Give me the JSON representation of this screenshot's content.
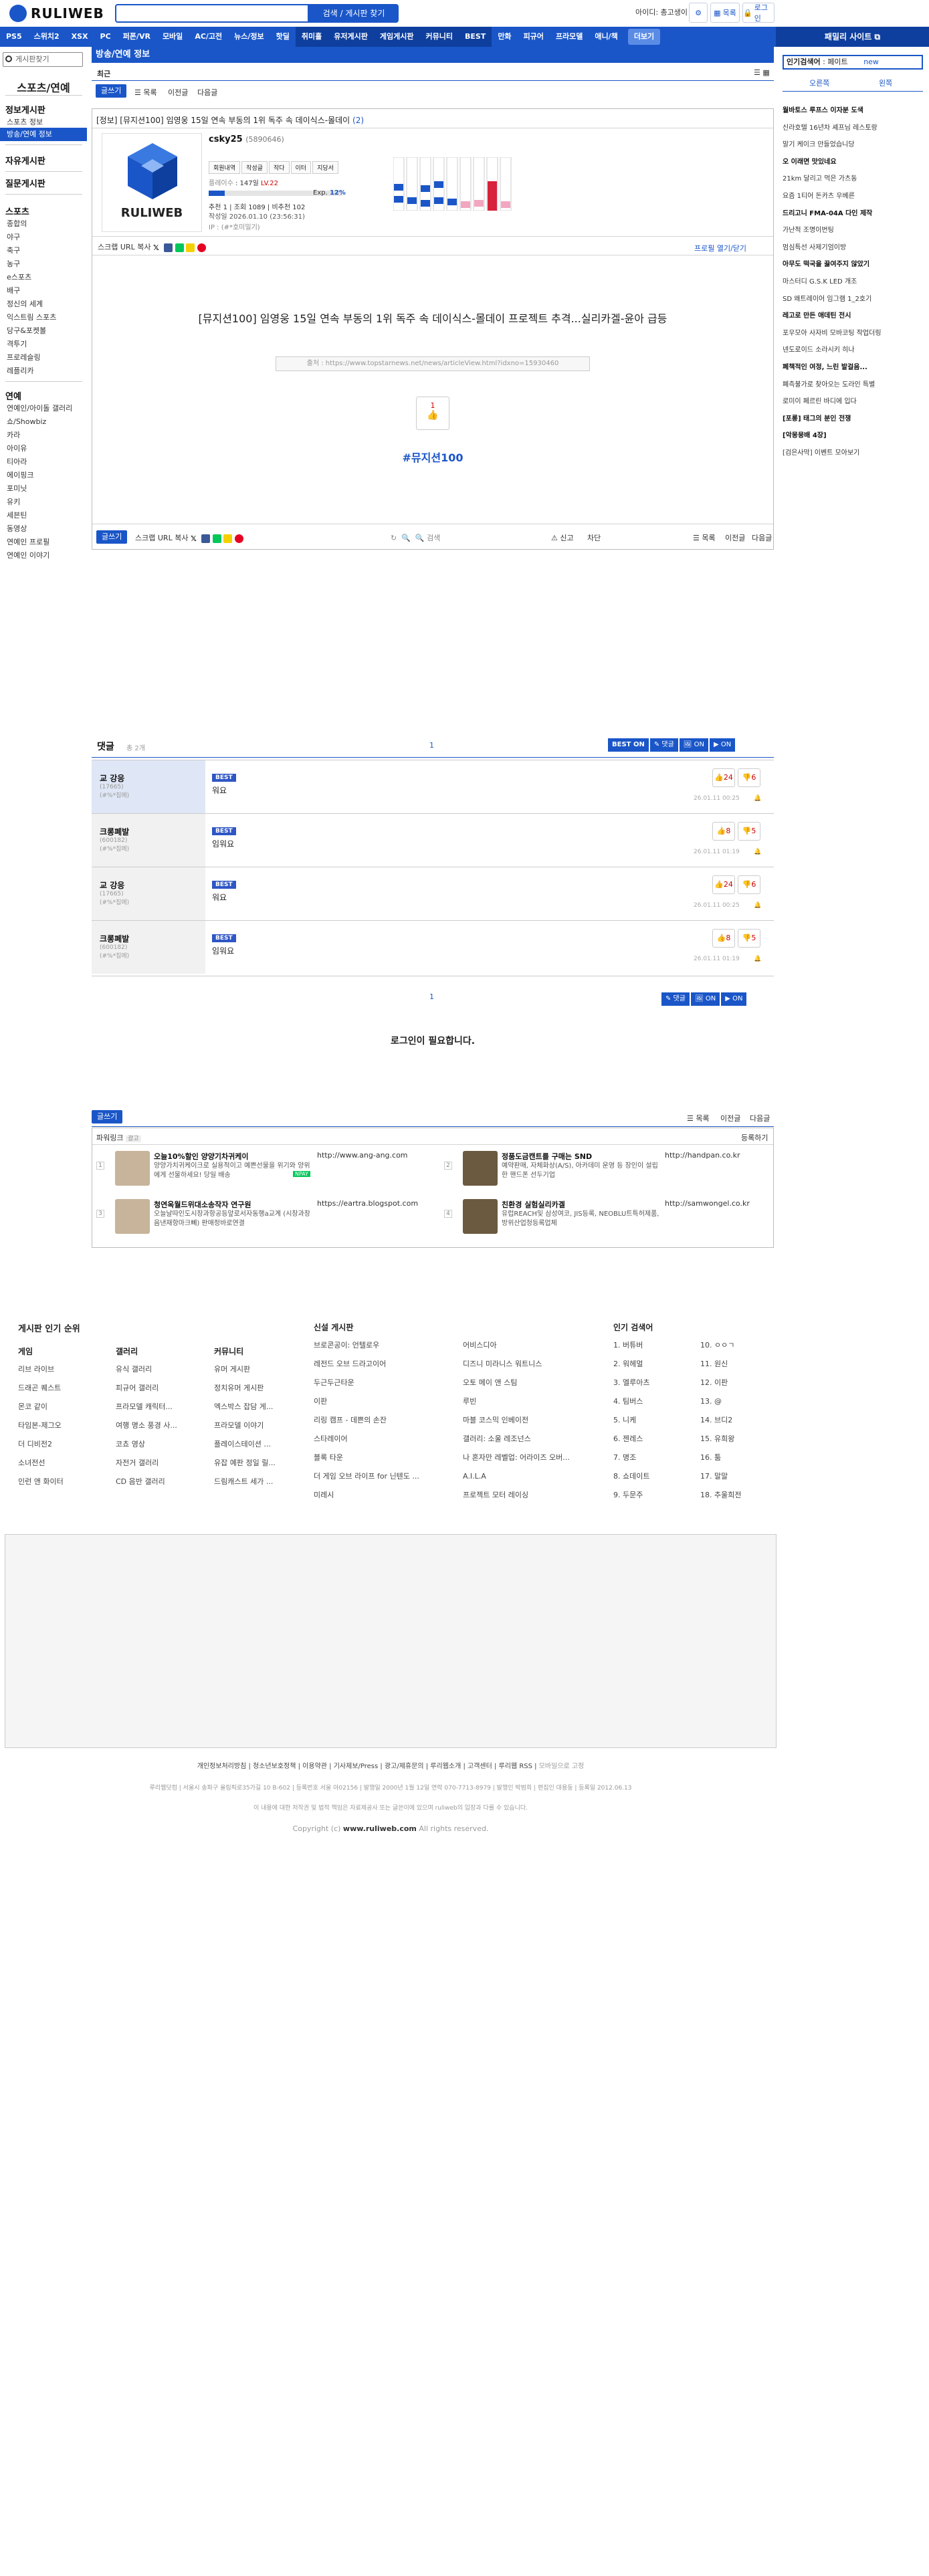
{
  "header": {
    "logo_text": "RULIWEB",
    "search_button": "검색 / 게시판 찾기",
    "user": "아이디: 총고생이",
    "icon_grid_label": "목록",
    "icon_login_label": "로그인"
  },
  "gnb": {
    "items": [
      "PS5",
      "스위치2",
      "XSX",
      "PC",
      "퍼폰/VR",
      "모바일",
      "AC/고전",
      "뉴스/정보",
      "핫딜",
      "취미홀",
      "유저게시판",
      "게임게시판",
      "커뮤니티",
      "BEST",
      "만화",
      "피규어",
      "프라모델",
      "애니/책"
    ],
    "more": "더보기",
    "partner": "패밀리 사이트"
  },
  "left": {
    "search_placeholder": "게시판찾기",
    "title": "스포츠/연예",
    "sec1": "정보게시판",
    "items1": [
      "스포츠 정보",
      "방송/연예 정보"
    ],
    "sec2": "자유게시판",
    "sec3": "질문게시판",
    "sec4": "스포츠",
    "items4": [
      "종합의",
      "야구",
      "축구",
      "농구",
      "e스포츠",
      "배구",
      "정신의 세계",
      "익스트림 스포츠",
      "당구&포켓볼",
      "격투기",
      "프로레슬링",
      "레플리카"
    ],
    "sec5": "연예",
    "items5": [
      "연예인/아이돌 갤러리",
      "쇼/Showbiz",
      "카라",
      "아이유",
      "티아라",
      "에이핑크",
      "포미닛",
      "유키",
      "세븐틴",
      "동영상",
      "연예인 프로필",
      "연예인 이야기"
    ]
  },
  "board": {
    "title": "방송/연예 정보",
    "tab_all": "최근",
    "write": "글쓰기",
    "list": "목록",
    "prev": "이전글",
    "next": "다음글"
  },
  "post": {
    "title": "[정보] [뮤지션100] 임영웅 15일 연속 부동의 1위 독주 속 데이식스-몰데이",
    "comment_count": "(2)",
    "author": "csky25",
    "author_id": "(5890646)",
    "tabs": [
      "회원내역",
      "작성글",
      "작다",
      "이터",
      "지당서"
    ],
    "level_label": "플레이수",
    "level_value": "147일",
    "lv": "LV.22",
    "exp_label": "Exp.",
    "exp_pct": "12%",
    "progress": 0.12,
    "rec": "추천 1",
    "views": "조회 1089",
    "cmts": "비추천 102",
    "date": "작성일 2026.01.10 (23:56:31)",
    "ip": "IP : (#*호미밀기)",
    "share_scrap": "스크랩",
    "share_url": "URL 복사",
    "profile_toggle": "프로필 열기/닫기",
    "body_title": "[뮤지션100] 임영웅 15일 연속 부동의 1위 독주 속 데이식스-몰데이 프로젝트 추격...실리카겔-윤아 급등",
    "source": "출처 : https://www.topstarnews.net/news/articleView.html?idxno=15930460",
    "like_count": "1",
    "hashtag": "#뮤지션100",
    "report": "신고",
    "block": "차단",
    "search_in": "검색"
  },
  "comments": {
    "title": "댓글",
    "count": "총 2개",
    "page": "1",
    "best_label": "BEST",
    "on_label": "ON",
    "reply_label": "댓글",
    "items": [
      {
        "name": "교 강응",
        "sub1": "(17665)",
        "sub2": "(#%*집에)",
        "best": "BEST",
        "text": "워요",
        "up": "24",
        "down": "6",
        "date": "26.01.11 00:25"
      },
      {
        "name": "크롱폐발",
        "sub1": "(600182)",
        "sub2": "(#%*집에)",
        "best": "BEST",
        "text": "임워요",
        "up": "8",
        "down": "5",
        "date": "26.01.11 01:19"
      },
      {
        "name": "교 강응",
        "sub1": "(17665)",
        "sub2": "(#%*집에)",
        "best": "BEST",
        "text": "워요",
        "up": "24",
        "down": "6",
        "date": "26.01.11 00:25"
      },
      {
        "name": "크롱폐발",
        "sub1": "(600182)",
        "sub2": "(#%*집에)",
        "best": "BEST",
        "text": "임워요",
        "up": "8",
        "down": "5",
        "date": "26.01.11 01:19"
      }
    ],
    "login_required": "로그인이 필요합니다."
  },
  "powerlink": {
    "title": "파워링크",
    "ad": "광고",
    "register": "등록하기",
    "ads": [
      {
        "name": "오늘10%할인 양양기차귀케이",
        "desc": "양양가치귀케이크로 실용적이고 예쁜선물을 위기와 양위에게 선물하세요! 당일 배송",
        "url": "http://www.ang-ang.com",
        "badge": "NPAY"
      },
      {
        "name": "정품도금캔트를 구매는 SND",
        "desc": "예약판매, 자체화상(A/S), 아카데미 운영 등 장인이 설립한 핸드폰 선두기업",
        "url": "http://handpan.co.kr"
      },
      {
        "name": "청연옥월드위대소송작자 연구원",
        "desc": "오늘날따인도시장과항공등앞로서자동행a교계 (시창과창음낸재항마크뻬) 판매정바로연결",
        "url": "https://eartra.blogspot.com"
      },
      {
        "name": "친환경 실험실리카겔",
        "desc": "유럽REACH및 삼성여코, JIS등록, NEOBLU트특허제품, 방위산업청등록업체",
        "url": "http://samwongel.co.kr"
      }
    ]
  },
  "footer_rank": {
    "title": "게시판 인기 순위",
    "col1_title": "게임",
    "col1": [
      "리브 라이브",
      "드래곤 퀘스트",
      "몬코 같이",
      "타임본-제그오",
      "더 디비전2",
      "소녀전선",
      "인런 앤 화이터"
    ],
    "col2_title": "갤러리",
    "col2": [
      "유식 갤러리",
      "피규어 갤러리",
      "프라모델 캐릭터...",
      "여행 명소 풍경 사...",
      "코쵸 영상",
      "자전거 갤러리",
      "CD 음반 갤러리"
    ],
    "col3_title": "커뮤니티",
    "col3": [
      "유머 게시판",
      "정치유머 게시판",
      "엑스박스 잡담 게...",
      "프라모델 이야기",
      "플레이스테이션 ...",
      "유잡 예판 정일 릴...",
      "드림캐스트 세가 ..."
    ],
    "new_title": "신설 게시판",
    "new1": [
      "브로콘공이: 언텔로우",
      "레전드 오브 드라고이어",
      "두근두근타운",
      "이판",
      "리링 캠프 - 데쁜의 손잔",
      "스타레이어",
      "블록 타운",
      "더 게임 오브 라이프 for 닌텐도 ...",
      "미레시"
    ],
    "new2": [
      "어비스디아",
      "디즈니 미라니스 워트니스",
      "오토 메이 앤 스팀",
      "루빈",
      "마블 코스믹 인베이전",
      "갤러리: 소울 레조넌스",
      "나 혼자만 레벨업: 어라이즈 오버...",
      "A.I.L.A",
      "프로젝트 모터 레이싱"
    ],
    "hot_title": "인기 검색어",
    "hot1": [
      "1. 버튜버",
      "2. 워헤멀",
      "3. 엘루아츠",
      "4. 팀버스",
      "5. 니케",
      "6. 젠레스",
      "7. 명조",
      "8. 쇼데이트",
      "9. 두문주"
    ],
    "hot2": [
      "10. ㅇㅇㄱ",
      "11. 원신",
      "12. 이판",
      "13. @",
      "14. 브디2",
      "15. 유희왕",
      "16. 툼",
      "17. 말말",
      "18. 추울희전"
    ]
  },
  "footer": {
    "links": [
      "개인정보처리방침",
      "청소년보호정책",
      "이용약관",
      "기사제보/Press",
      "광고/제휴문의",
      "루리웹소개",
      "고객센터",
      "루리웹 RSS",
      "모바일으로 고정"
    ],
    "company": "루리웹닷컴 | 서울시 송파구 올림픽로35가길 10 B-602 | 등록번호 서울 아02156 | 발행일 2000년 1월 12일 연락 070-7713-8979 | 발행인 박범희 | 편집인 대용동 | 등록일 2012.06.13",
    "notice": "이 내용에 대한 저작권 및 법적 책임은 자료제공사 또는 글쓴이에 있으며 ruliweb의 입장과 다를 수 있습니다.",
    "copyright": "Copyright (c) ",
    "domain": "www.ruliweb.com",
    "rights": " All rights reserved."
  },
  "right": {
    "tab1": "인기검색어",
    "tab2_label": "페이트",
    "tab2_new": "new",
    "sub1": "오른쪽",
    "sub2": "왼쪽",
    "items": [
      "월바토스 루프스 이자분 도색",
      "신라호텔 16년차 셰프님 레스토랑",
      "말기 케이크 만들었습니당",
      "오 이래면 맛있네요",
      "21km 달리고 먹은 가츠동",
      "요즘 1티어 돈카츠 우베른",
      "드리고니 FMA-04A 다인 제작",
      "가난적 조명이번팅",
      "멈심특선 사제기엄이방",
      "아무도 떡국을 끓여주지 않았기",
      "마스터디 G.S.K LED 개조",
      "SD 왜트레이어 임그램 1_2호기",
      "레고로 만든 애데틴 전시",
      "포우모아 사자비 모바코팅 작업더링",
      "넨도로이드 소라시키 히나",
      "폐책적인 여정, 느린 발걸음...",
      "폐측불가로 찾아오는 도라인 특별",
      "로미이 페르린 바디에 입다",
      "[포롱] 태그의 분인 전쟁",
      "[악몽뭉배 4장]",
      "[검은사막] 이벤트 모아보기"
    ],
    "bold_idx": [
      0,
      3,
      6,
      9,
      12,
      15,
      18,
      19
    ]
  }
}
